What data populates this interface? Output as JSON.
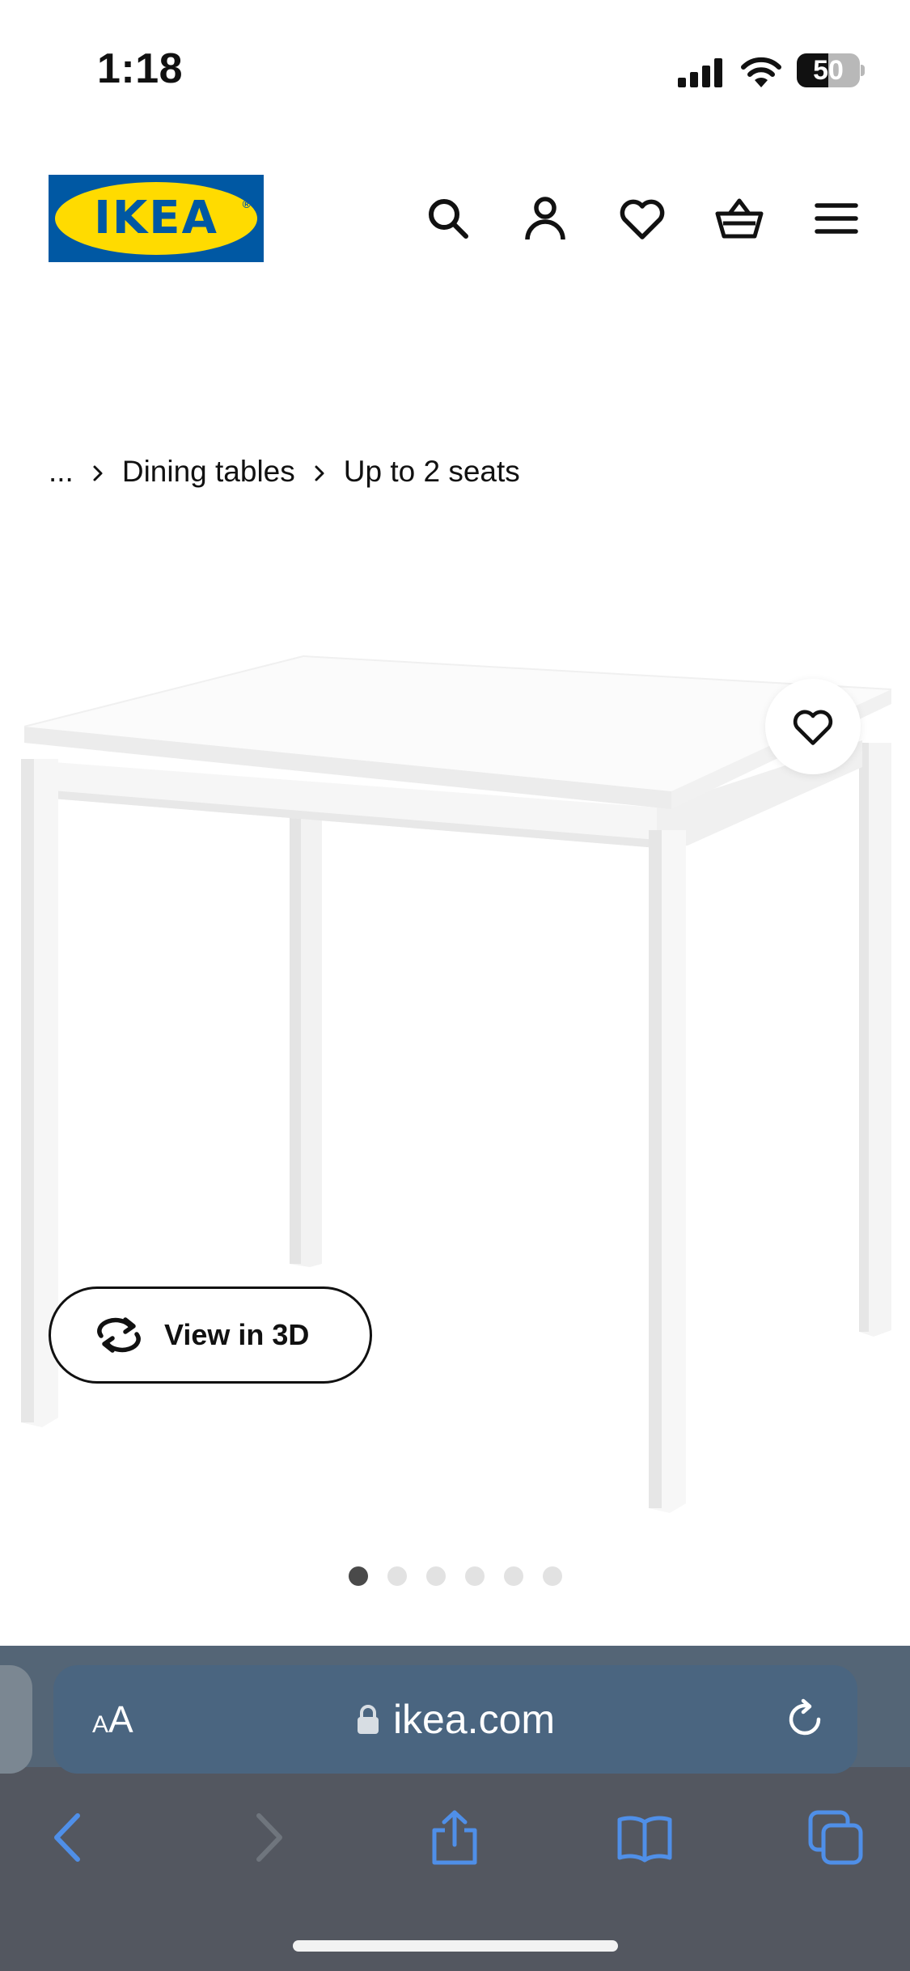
{
  "status_bar": {
    "time": "1:18",
    "battery_percent": 50,
    "battery_label": "50"
  },
  "header": {
    "logo_text": "IKEA",
    "logo_colors": {
      "blue": "#0058a3",
      "yellow": "#ffdb00"
    },
    "icons": [
      "search-icon",
      "account-icon",
      "heart-icon",
      "cart-icon",
      "menu-icon"
    ]
  },
  "breadcrumb": {
    "items": [
      "...",
      "Dining tables",
      "Up to 2 seats"
    ]
  },
  "product": {
    "view_3d_label": "View in 3D",
    "carousel": {
      "count": 6,
      "active_index": 0
    }
  },
  "safari": {
    "text_size_small": "A",
    "text_size_big": "A",
    "url": "ikea.com",
    "accent_color": "#4f8fe8"
  }
}
